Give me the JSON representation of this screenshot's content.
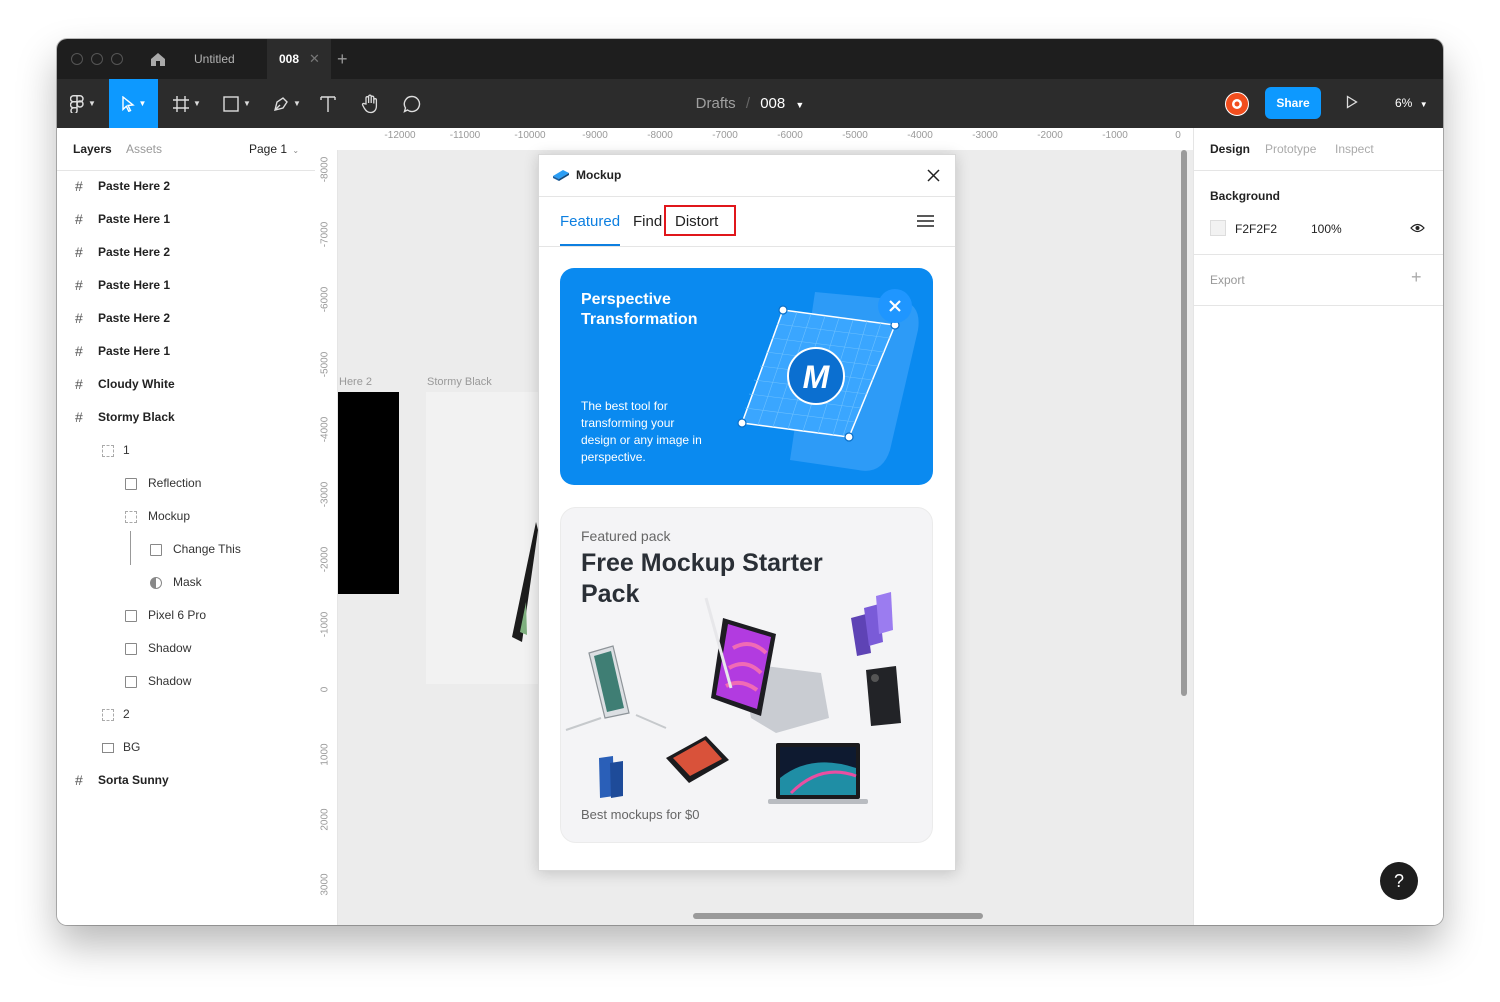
{
  "window": {
    "tabs": [
      {
        "label": "Untitled"
      },
      {
        "label": "008"
      }
    ]
  },
  "toolbar": {
    "breadcrumb_parent": "Drafts",
    "breadcrumb_sep": "/",
    "file_name": "008",
    "share_label": "Share",
    "zoom": "6%"
  },
  "left_panel": {
    "tabs": [
      "Layers",
      "Assets"
    ],
    "page": "Page 1",
    "layers": [
      {
        "label": "Paste Here 2",
        "type": "frame",
        "depth": 0
      },
      {
        "label": "Paste Here 1",
        "type": "frame",
        "depth": 0
      },
      {
        "label": "Paste Here 2",
        "type": "frame",
        "depth": 0
      },
      {
        "label": "Paste Here 1",
        "type": "frame",
        "depth": 0
      },
      {
        "label": "Paste Here 2",
        "type": "frame",
        "depth": 0
      },
      {
        "label": "Paste Here 1",
        "type": "frame",
        "depth": 0
      },
      {
        "label": "Cloudy White",
        "type": "frame",
        "depth": 0
      },
      {
        "label": "Stormy Black",
        "type": "frame",
        "depth": 0
      },
      {
        "label": "1",
        "type": "group",
        "depth": 1
      },
      {
        "label": "Reflection",
        "type": "image",
        "depth": 2
      },
      {
        "label": "Mockup",
        "type": "group",
        "depth": 2
      },
      {
        "label": "Change This",
        "type": "image",
        "depth": 3
      },
      {
        "label": "Mask",
        "type": "mask",
        "depth": 3
      },
      {
        "label": "Pixel 6 Pro",
        "type": "image",
        "depth": 2
      },
      {
        "label": "Shadow",
        "type": "image",
        "depth": 2
      },
      {
        "label": "Shadow",
        "type": "image",
        "depth": 2
      },
      {
        "label": "2",
        "type": "group",
        "depth": 1
      },
      {
        "label": "BG",
        "type": "rect",
        "depth": 1
      },
      {
        "label": "Sorta Sunny",
        "type": "frame",
        "depth": 0
      }
    ]
  },
  "rulers": {
    "horizontal": [
      "-12000",
      "-11000",
      "-10000",
      "-9000",
      "-8000",
      "-7000",
      "-6000",
      "-5000",
      "-4000",
      "-3000",
      "-2000",
      "-1000",
      "0"
    ],
    "vertical": [
      "-8000",
      "-7000",
      "-6000",
      "-5000",
      "-4000",
      "-3000",
      "-2000",
      "-1000",
      "0",
      "1000",
      "2000",
      "3000"
    ]
  },
  "canvas": {
    "frame_label_1": "Here 2",
    "frame_label_2": "Stormy Black"
  },
  "right_panel": {
    "tabs": [
      "Design",
      "Prototype",
      "Inspect"
    ],
    "background_title": "Background",
    "background_hex": "F2F2F2",
    "background_opacity": "100%",
    "export_title": "Export"
  },
  "plugin": {
    "title": "Mockup",
    "nav": [
      "Featured",
      "Find",
      "Distort"
    ],
    "banner": {
      "title_line1": "Perspective",
      "title_line2": "Transformation",
      "description_lines": [
        "The best tool for",
        "transforming your",
        "design or any image in",
        "perspective."
      ],
      "logo_letter": "M"
    },
    "pack": {
      "eyebrow": "Featured pack",
      "title_line1": "Free Mockup Starter",
      "title_line2": "Pack",
      "footer": "Best mockups for $0"
    }
  },
  "help_label": "?",
  "colors": {
    "accent": "#0d99ff",
    "plugin_accent": "#0d7fe0",
    "banner_bg": "#0a8af0",
    "highlight": "#e0161b",
    "chrome_dark": "#2c2c2c"
  }
}
